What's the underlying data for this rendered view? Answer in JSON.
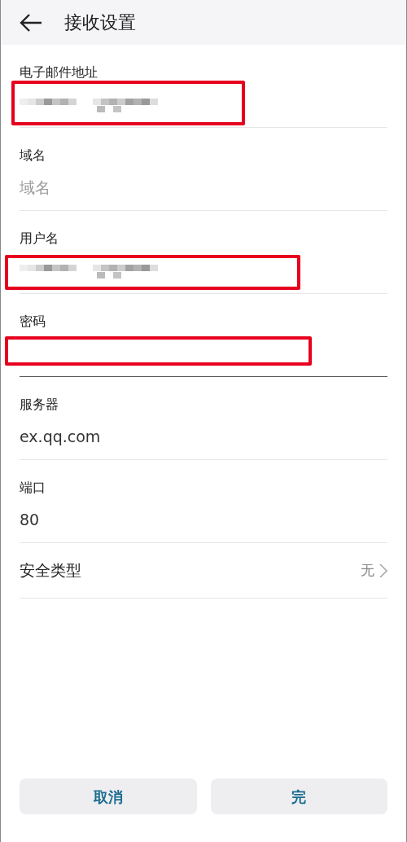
{
  "header": {
    "title": "接收设置"
  },
  "fields": [
    {
      "kind": "redacted",
      "label": "电子邮件地址",
      "highlighted": true,
      "focused": false
    },
    {
      "kind": "placeholder",
      "label": "域名",
      "placeholder": "域名",
      "highlighted": false,
      "focused": false
    },
    {
      "kind": "redacted",
      "label": "用户名",
      "highlighted": true,
      "focused": false
    },
    {
      "kind": "empty",
      "label": "密码",
      "highlighted": true,
      "focused": true
    },
    {
      "kind": "value",
      "label": "服务器",
      "value": "ex.qq.com",
      "highlighted": false,
      "focused": false
    },
    {
      "kind": "value",
      "label": "端口",
      "value": "80",
      "highlighted": false,
      "focused": false
    }
  ],
  "security": {
    "label": "安全类型",
    "value": "无"
  },
  "buttons": [
    "取消",
    "完"
  ]
}
